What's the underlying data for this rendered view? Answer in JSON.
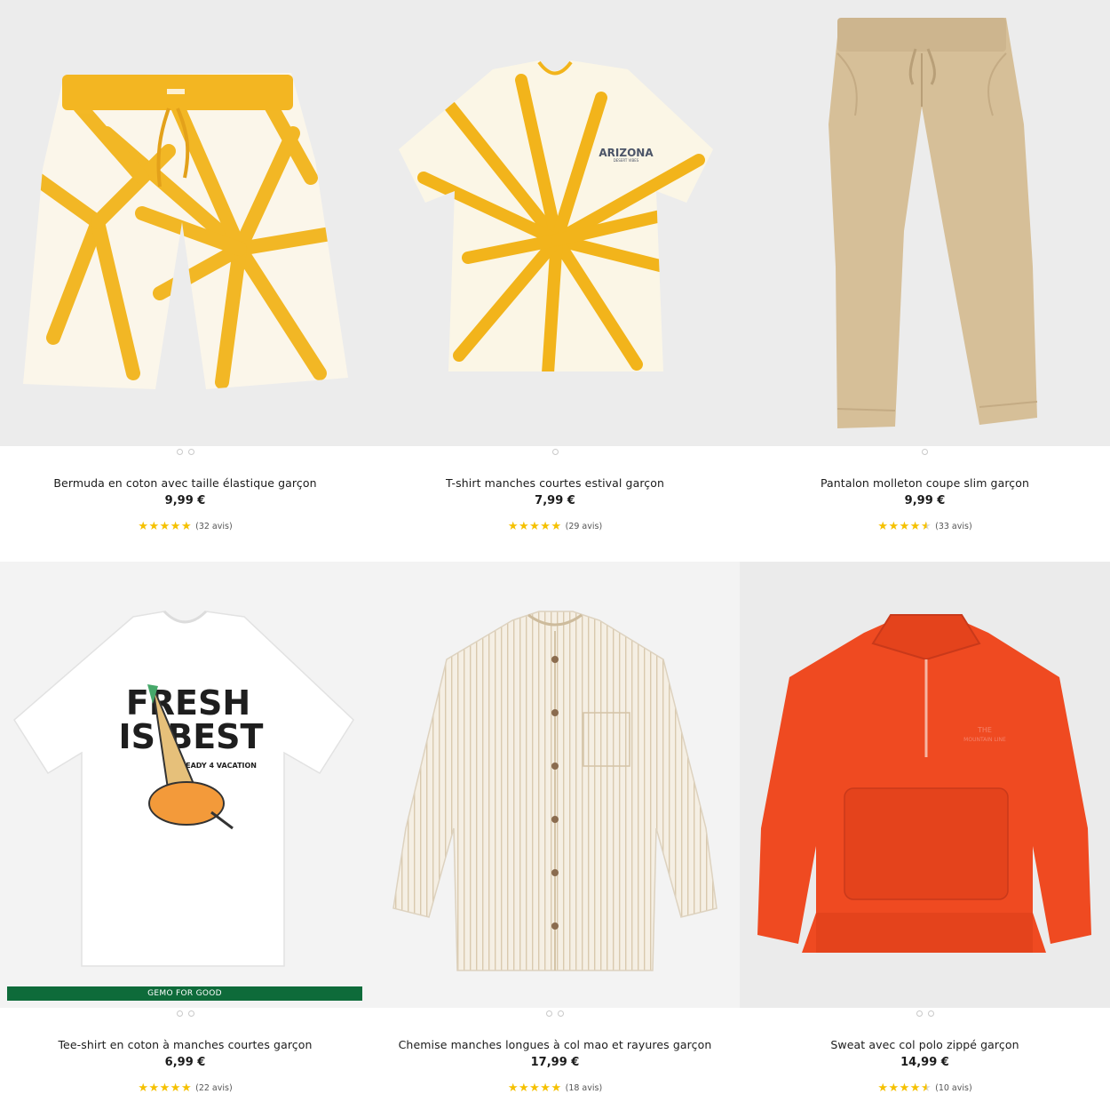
{
  "products": [
    {
      "name": "Bermuda en coton avec taille élastique garçon",
      "price": "9,99 €",
      "rating": 5,
      "reviews": "(32 avis)",
      "dots": 2,
      "bg": "#ececec"
    },
    {
      "name": "T-shirt manches courtes estival garçon",
      "price": "7,99 €",
      "rating": 5,
      "reviews": "(29 avis)",
      "dots": 1,
      "bg": "#ececec",
      "print_text": "ARIZONA",
      "print_sub": "DESERT VIBES"
    },
    {
      "name": "Pantalon molleton coupe slim garçon",
      "price": "9,99 €",
      "rating": 4.5,
      "reviews": "(33 avis)",
      "dots": 1,
      "bg": "#ececec"
    },
    {
      "name": "Tee-shirt en coton à manches courtes garçon",
      "price": "6,99 €",
      "rating": 5,
      "reviews": "(22 avis)",
      "dots": 2,
      "bg": "#f3f3f3",
      "badge": "GEMO FOR GOOD",
      "print_text": "FRESH",
      "print_text2": "IS BEST",
      "print_sub": "READY 4 VACATION"
    },
    {
      "name": "Chemise manches longues à col mao et rayures garçon",
      "price": "17,99 €",
      "rating": 5,
      "reviews": "(18 avis)",
      "dots": 2,
      "bg": "#f3f3f3"
    },
    {
      "name": "Sweat avec col polo zippé garçon",
      "price": "14,99 €",
      "rating": 4.5,
      "reviews": "(10 avis)",
      "dots": 2,
      "bg": "#ebebeb",
      "print_text": "THE",
      "print_sub": "MOUNTAIN LINE"
    }
  ],
  "colors": {
    "star": "#f5c100",
    "badge": "#0e6b3a",
    "tiedye": "#f2b41b",
    "khaki": "#d6bf98",
    "orange": "#ef4a21"
  }
}
